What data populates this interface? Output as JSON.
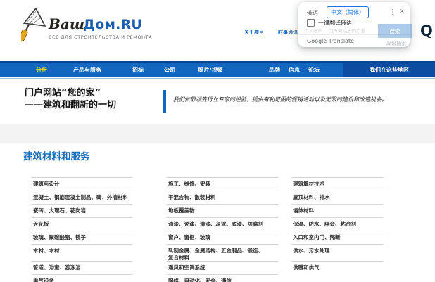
{
  "brand": {
    "word1": "Ваш",
    "word2": "Дом.RU",
    "tagline": "ВСЕ ДЛЯ СТРОИТЕЛЬСТВА И РЕМОНТА",
    "logo_blue": "#1b5eae"
  },
  "header": {
    "about_link": "关于项目",
    "newsletter_link": "时事通讯",
    "obscured_account_link": "个人账户",
    "obscured_ads_link": "门户网站上的广告",
    "search_button_label": "搜索",
    "obscured_subtext": "高级搜索",
    "search_icon": "Q",
    "link_color": "#1766c2"
  },
  "translate_popup": {
    "tab_source": "俄语",
    "tab_target": "中文（简体）",
    "menu_icon": "⋮",
    "close_icon": "✕",
    "checkbox_label": "一律翻译俄语",
    "brand": "Google Translate",
    "accent": "#1a73e8"
  },
  "nav": {
    "bg": "#1266bd",
    "active_bg": "#0c4da2",
    "active_color": "#f2e11b",
    "items": [
      {
        "label": "分析"
      },
      {
        "label": "产品与服务"
      },
      {
        "label": "招标"
      },
      {
        "label": "公司"
      },
      {
        "label": "照片/视频"
      },
      {
        "label": "品牌"
      },
      {
        "label": "信息"
      },
      {
        "label": "论坛"
      },
      {
        "label": "我们在这些地区"
      }
    ]
  },
  "hero": {
    "title_line1": "门户网站“您的家”",
    "title_line2": "——建筑和翻新的一切",
    "quote": "我们依靠领先行业专家的经验，提供有利可图的促销活动以及无限的建设和改造机会。"
  },
  "catalog": {
    "title": "建筑材料和服务",
    "rows": [
      [
        "建筑与设计",
        "施工、维修、安装",
        "建筑增材技术"
      ],
      [
        "混凝土、钢筋混凝土制品、砖、外墙材料",
        "干混合物、散装材料",
        "屋顶材料、排水"
      ],
      [
        "瓷砖、大理石、花岗岩",
        "地板覆盖物",
        "墙体材料"
      ],
      [
        "天花板",
        "油漆、瓷漆、清漆、灰泥、底漆、防腐剂",
        "保温、防水、隔音、粘合剂"
      ],
      [
        "玻璃、聚碳酸酯、镜子",
        "窗户、窗框、玻璃",
        "入口和室内门、隔断"
      ],
      [
        "木材、木材",
        "轧制金属、金属结构、五金制品、锻造、\n复合材料",
        "供水、污水处理"
      ],
      [
        "管道、浴室、游泳池",
        "通风和空调系统",
        "供暖和供气"
      ],
      [
        "电气设备",
        "网络、自动化、安全、通信",
        ""
      ]
    ]
  }
}
